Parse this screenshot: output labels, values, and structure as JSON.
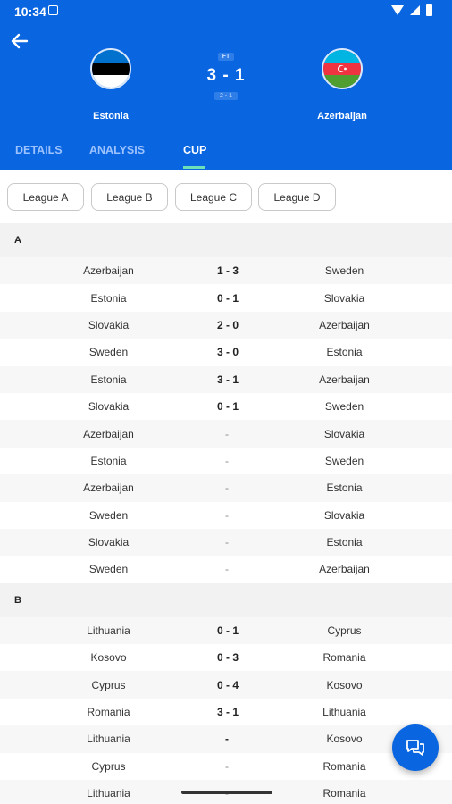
{
  "status_bar": {
    "time": "10:34"
  },
  "match": {
    "status": "FT",
    "score": "3 - 1",
    "half_time": "2 - 1",
    "home": {
      "name": "Estonia",
      "flag_colors": [
        "#0072ce",
        "#000000",
        "#ffffff"
      ]
    },
    "away": {
      "name": "Azerbaijan",
      "flag_colors": [
        "#00b5e2",
        "#ef3340",
        "#509e2f"
      ]
    }
  },
  "tabs": [
    {
      "label": "DETAILS"
    },
    {
      "label": "ANALYSIS"
    },
    {
      "label": "CUP"
    }
  ],
  "filters": [
    {
      "label": "League A"
    },
    {
      "label": "League B"
    },
    {
      "label": "League C"
    },
    {
      "label": "League D"
    }
  ],
  "groups": [
    {
      "name": "A",
      "matches": [
        {
          "home": "Azerbaijan",
          "score": "1 - 3",
          "away": "Sweden"
        },
        {
          "home": "Estonia",
          "score": "0 - 1",
          "away": "Slovakia"
        },
        {
          "home": "Slovakia",
          "score": "2 - 0",
          "away": "Azerbaijan"
        },
        {
          "home": "Sweden",
          "score": "3 - 0",
          "away": "Estonia"
        },
        {
          "home": "Estonia",
          "score": "3 - 1",
          "away": "Azerbaijan"
        },
        {
          "home": "Slovakia",
          "score": "0 - 1",
          "away": "Sweden"
        },
        {
          "home": "Azerbaijan",
          "score": "-",
          "away": "Slovakia"
        },
        {
          "home": "Estonia",
          "score": "-",
          "away": "Sweden"
        },
        {
          "home": "Azerbaijan",
          "score": "-",
          "away": "Estonia"
        },
        {
          "home": "Sweden",
          "score": "-",
          "away": "Slovakia"
        },
        {
          "home": "Slovakia",
          "score": "-",
          "away": "Estonia"
        },
        {
          "home": "Sweden",
          "score": "-",
          "away": "Azerbaijan"
        }
      ]
    },
    {
      "name": "B",
      "matches": [
        {
          "home": "Lithuania",
          "score": "0 - 1",
          "away": "Cyprus"
        },
        {
          "home": "Kosovo",
          "score": "0 - 3",
          "away": "Romania"
        },
        {
          "home": "Cyprus",
          "score": "0 - 4",
          "away": "Kosovo"
        },
        {
          "home": "Romania",
          "score": "3 - 1",
          "away": "Lithuania"
        },
        {
          "home": "Lithuania",
          "score": "-",
          "away": "Kosovo"
        },
        {
          "home": "Cyprus",
          "score": "-",
          "away": "Romania"
        },
        {
          "home": "Lithuania",
          "score": "-",
          "away": "Romania"
        }
      ]
    }
  ],
  "colors": {
    "primary": "#0a66e0",
    "tab_indicator": "#6ee0b7"
  }
}
